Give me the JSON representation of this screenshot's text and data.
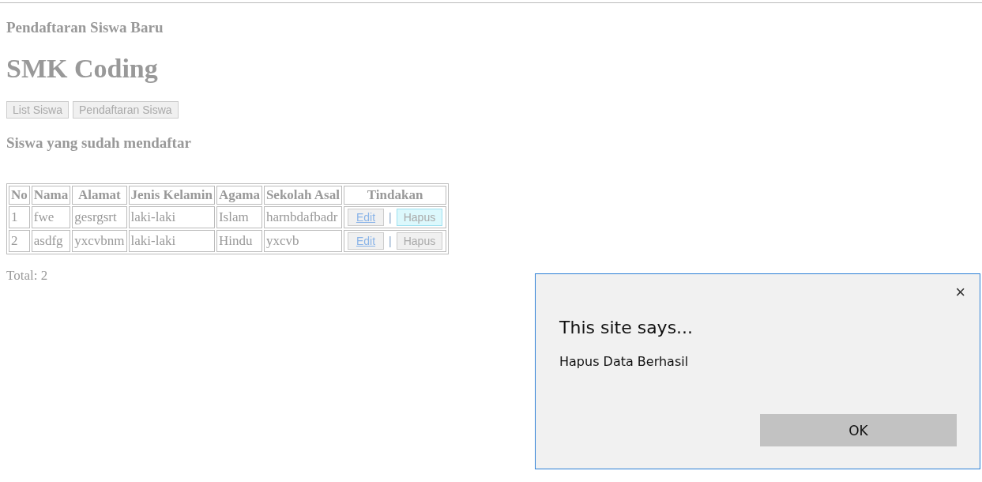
{
  "page": {
    "subtitle": "Pendaftaran Siswa Baru",
    "title": "SMK Coding",
    "nav_buttons": [
      {
        "label": "List Siswa"
      },
      {
        "label": "Pendaftaran Siswa"
      }
    ],
    "section_title": "Siswa yang sudah mendaftar",
    "table": {
      "columns": [
        "No",
        "Nama",
        "Alamat",
        "Jenis Kelamin",
        "Agama",
        "Sekolah Asal",
        "Tindakan"
      ],
      "rows": [
        {
          "cells": [
            "1",
            "fwe",
            "gesrgsrt",
            "laki-laki",
            "Islam",
            "harnbdafbadr"
          ],
          "edit": "Edit",
          "separator": "|",
          "delete": {
            "label": "Hapus",
            "highlighted": true
          }
        },
        {
          "cells": [
            "2",
            "asdfg",
            "yxcvbnm",
            "laki-laki",
            "Hindu",
            "yxcvb"
          ],
          "edit": "Edit",
          "separator": "|",
          "delete": {
            "label": "Hapus",
            "highlighted": false
          }
        }
      ]
    },
    "total": "Total: 2"
  },
  "dialog": {
    "title": "This site says...",
    "message": "Hapus Data Berhasil",
    "close": "×",
    "ok": "OK"
  }
}
